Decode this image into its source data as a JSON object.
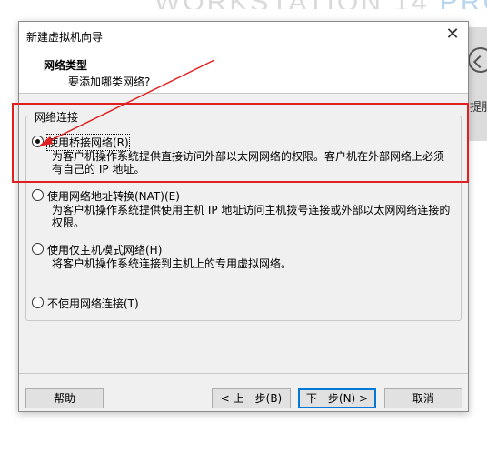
{
  "background": {
    "banner_main": "WORKSTATION 14 ",
    "banner_pro": "PRO",
    "side_text": "提服"
  },
  "dialog": {
    "title": "新建虚拟机向导",
    "close_glyph": "✕",
    "header_title": "网络类型",
    "header_subtitle": "要添加哪类网络?",
    "group_label": "网络连接",
    "options": [
      {
        "label": "使用桥接网络(R)",
        "selected": true,
        "description": "为客户机操作系统提供直接访问外部以太网网络的权限。客户机在外部网络上必须\n有自己的 IP 地址。"
      },
      {
        "label": "使用网络地址转换(NAT)(E)",
        "selected": false,
        "description": "为客户机操作系统提供使用主机 IP 地址访问主机拨号连接或外部以太网网络连接的\n权限。"
      },
      {
        "label": "使用仅主机模式网络(H)",
        "selected": false,
        "description": "将客户机操作系统连接到主机上的专用虚拟网络。"
      },
      {
        "label": "不使用网络连接(T)",
        "selected": false,
        "description": ""
      }
    ],
    "buttons": {
      "help": "帮助",
      "back": "< 上一步(B)",
      "next": "下一步(N) >",
      "cancel": "取消"
    }
  },
  "colors": {
    "annotation_red": "#e02020",
    "dialog_bg": "#f0f0f0",
    "primary_border": "#0078d7"
  }
}
